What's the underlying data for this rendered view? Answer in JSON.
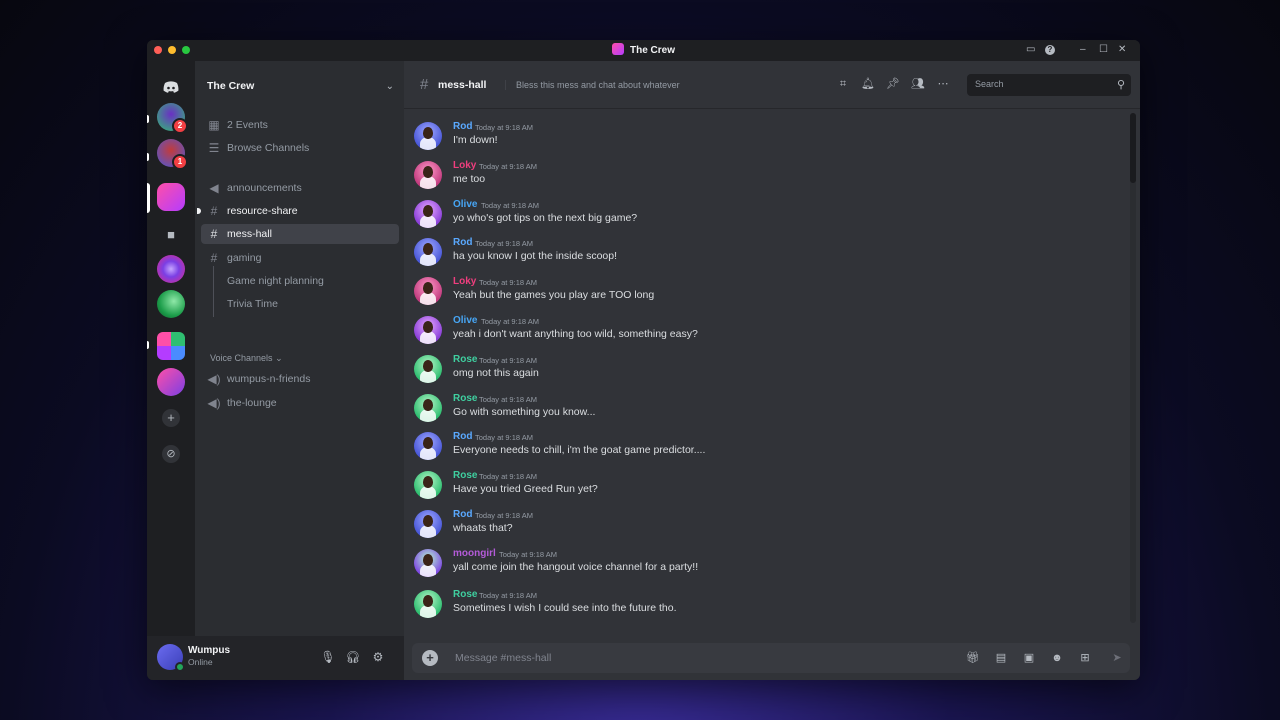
{
  "window": {
    "title": "The Crew"
  },
  "servers": [
    {
      "name": "server-1",
      "badge": "2",
      "color": "#2fbf71"
    },
    {
      "name": "server-2",
      "badge": "1",
      "color": "#4a58d8"
    },
    {
      "name": "server-the-crew",
      "badge": "",
      "color": "#ff4fa8"
    }
  ],
  "sidebar": {
    "server_name": "The Crew",
    "events": "2 Events",
    "browse": "Browse Channels",
    "channels": [
      {
        "label": "announcements"
      },
      {
        "label": "resource-share"
      },
      {
        "label": "mess-hall"
      },
      {
        "label": "gaming"
      },
      {
        "label": "Game night planning"
      },
      {
        "label": "Trivia Time"
      }
    ],
    "voice_category": "Voice Channels",
    "voice_channels": [
      {
        "label": "wumpus-n-friends"
      },
      {
        "label": "the-lounge"
      }
    ]
  },
  "user": {
    "name": "Wumpus",
    "status": "Online"
  },
  "header": {
    "channel": "mess-hall",
    "topic": "Bless this mess and chat about whatever",
    "search_placeholder": "Search"
  },
  "messages": [
    {
      "author": "Rod",
      "color": "#5aa9ff",
      "time": "Today at 9:18 AM",
      "text": "I'm down!"
    },
    {
      "author": "Loky",
      "color": "#ef3e7e",
      "time": "Today at 9:18 AM",
      "text": "me too"
    },
    {
      "author": "Olive",
      "color": "#47a6f5",
      "time": "Today at 9:18 AM",
      "text": "yo who's got tips on the next big game?"
    },
    {
      "author": "Rod",
      "color": "#5aa9ff",
      "time": "Today at 9:18 AM",
      "text": "ha you know I got the inside scoop!"
    },
    {
      "author": "Loky",
      "color": "#ef3e7e",
      "time": "Today at 9:18 AM",
      "text": "Yeah but the games you play are TOO long"
    },
    {
      "author": "Olive",
      "color": "#47a6f5",
      "time": "Today at 9:18 AM",
      "text": "yeah i don't want anything too wild, something easy?"
    },
    {
      "author": "Rose",
      "color": "#3fd0a0",
      "time": "Today at 9:18 AM",
      "text": "omg not this again"
    },
    {
      "author": "Rose",
      "color": "#3fd0a0",
      "time": "Today at 9:18 AM",
      "text": "Go with something you know..."
    },
    {
      "author": "Rod",
      "color": "#5aa9ff",
      "time": "Today at 9:18 AM",
      "text": "Everyone needs to chill, i'm the goat game predictor...."
    },
    {
      "author": "Rose",
      "color": "#3fd0a0",
      "time": "Today at 9:18 AM",
      "text": "Have you tried Greed Run yet?"
    },
    {
      "author": "Rod",
      "color": "#5aa9ff",
      "time": "Today at 9:18 AM",
      "text": "whaats that?"
    },
    {
      "author": "moongirl",
      "color": "#b45bd9",
      "time": "Today at 9:18 AM",
      "text": "yall come join the hangout voice channel for a party!!"
    },
    {
      "author": "Rose",
      "color": "#3fd0a0",
      "time": "Today at 9:18 AM",
      "text": "Sometimes I wish I could see into the future tho."
    }
  ],
  "composer": {
    "placeholder": "Message #mess-hall"
  }
}
